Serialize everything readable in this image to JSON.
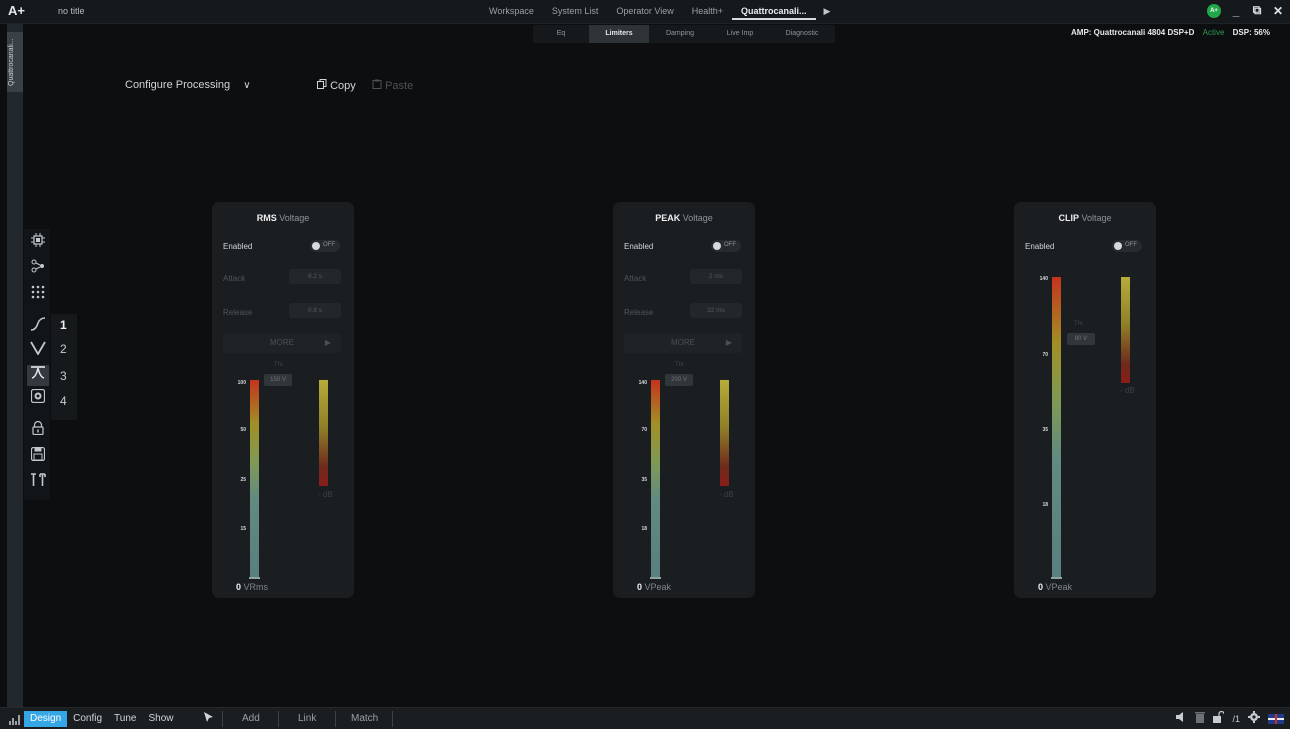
{
  "app": {
    "logo": "A+",
    "doc_title": "no title"
  },
  "nav": {
    "tabs": [
      {
        "label": "Workspace"
      },
      {
        "label": "System List"
      },
      {
        "label": "Operator View"
      },
      {
        "label": "Health+"
      },
      {
        "label": "Quattrocanali..."
      }
    ],
    "active_tab": "Quattrocanali...",
    "more_arrow": "▶"
  },
  "window": {
    "badge": "A+",
    "minimize": "_",
    "restore": "⧉",
    "close": "✕"
  },
  "subtabs": [
    {
      "label": "Eq"
    },
    {
      "label": "Limiters"
    },
    {
      "label": "Damping"
    },
    {
      "label": "Live Imp"
    },
    {
      "label": "Diagnostic"
    }
  ],
  "amp": {
    "name": "AMP: Quattrocanali 4804 DSP+D",
    "status": "Active",
    "dsp": "DSP: 56%"
  },
  "side_tab": {
    "label": "Quattrocanali..."
  },
  "toolbar_icons": [
    {
      "name": "chip-icon"
    },
    {
      "name": "routing-icon"
    },
    {
      "name": "matrix-icon"
    },
    {
      "name": "highpass-icon"
    },
    {
      "name": "eq-notch-icon"
    },
    {
      "name": "limiter-icon"
    },
    {
      "name": "speaker-icon"
    },
    {
      "name": "lock-icon"
    },
    {
      "name": "save-icon"
    },
    {
      "name": "tools-icon"
    }
  ],
  "channels": [
    "1",
    "2",
    "3",
    "4"
  ],
  "configure": {
    "label": "Configure Processing",
    "chevron": "∨"
  },
  "actions": {
    "copy": "Copy",
    "paste": "Paste"
  },
  "panels": [
    {
      "title_bold": "RMS",
      "title_rest": "Voltage",
      "enabled_label": "Enabled",
      "toggle": "OFF",
      "attack_label": "Attack",
      "attack_value": "8.2 s",
      "release_label": "Release",
      "release_value": "0.8 s",
      "more": "MORE",
      "threshold_label": "Thr.",
      "threshold_value": "150 V",
      "db_label": "- dB",
      "ticks": [
        "100",
        "50",
        "25",
        "15"
      ],
      "zero": "0",
      "unit": "VRms"
    },
    {
      "title_bold": "PEAK",
      "title_rest": "Voltage",
      "enabled_label": "Enabled",
      "toggle": "OFF",
      "attack_label": "Attack",
      "attack_value": "2 ms",
      "release_label": "Release",
      "release_value": "32 ms",
      "more": "MORE",
      "threshold_label": "Thr.",
      "threshold_value": "200 V",
      "db_label": "- dB",
      "ticks": [
        "140",
        "70",
        "35",
        "18"
      ],
      "zero": "0",
      "unit": "VPeak"
    },
    {
      "title_bold": "CLIP",
      "title_rest": "Voltage",
      "enabled_label": "Enabled",
      "toggle": "OFF",
      "threshold_label": "Thr.",
      "threshold_value": "80 V",
      "db_label": "- dB",
      "ticks": [
        "140",
        "70",
        "35",
        "18"
      ],
      "zero": "0",
      "unit": "VPeak"
    }
  ],
  "bottom": {
    "modes": [
      "Design",
      "Config",
      "Tune",
      "Show"
    ],
    "active_mode": "Design",
    "buttons": [
      "Add",
      "Link",
      "Match"
    ],
    "page": "/1"
  }
}
